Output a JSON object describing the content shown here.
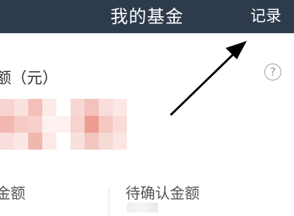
{
  "header": {
    "title": "我的基金",
    "right_action": "记录",
    "background_color": "#2e3b4c"
  },
  "asset_section": {
    "label": "额（元）",
    "help_icon": "help-circle-icon",
    "help_glyph": "?"
  },
  "summary": {
    "left_label": "金额",
    "right_label": "待确认金额"
  },
  "annotation": {
    "icon": "arrow-icon",
    "color": "#000000"
  }
}
